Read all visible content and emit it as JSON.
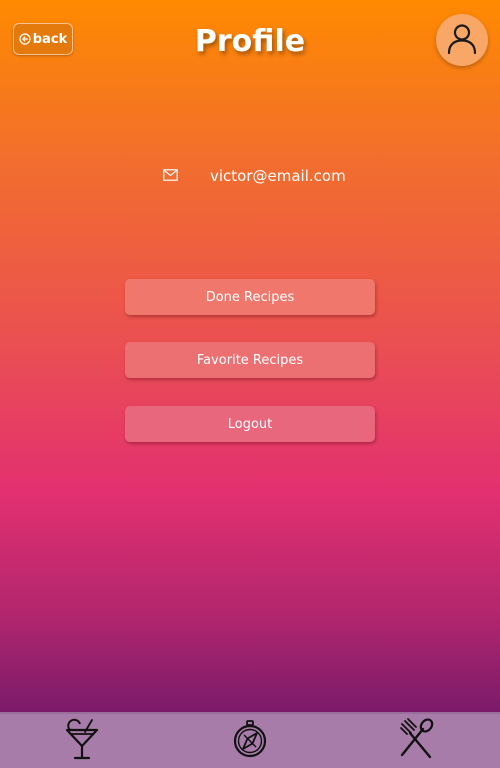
{
  "header": {
    "back_label": "back",
    "title": "Profile",
    "avatar_icon": "user-icon"
  },
  "profile": {
    "email": "victor@email.com",
    "email_icon": "mail-icon"
  },
  "actions": {
    "done_recipes": "Done Recipes",
    "favorite_recipes": "Favorite Recipes",
    "logout": "Logout"
  },
  "footer": {
    "items": [
      {
        "icon": "cocktail-icon"
      },
      {
        "icon": "compass-icon"
      },
      {
        "icon": "fork-knife-icon"
      }
    ]
  },
  "colors": {
    "gradient_top": "#ff8a00",
    "gradient_mid": "#e33070",
    "gradient_bottom": "#7a1a6a",
    "footer_bg": "#a77ca8",
    "avatar_bg": "#f9a766"
  }
}
